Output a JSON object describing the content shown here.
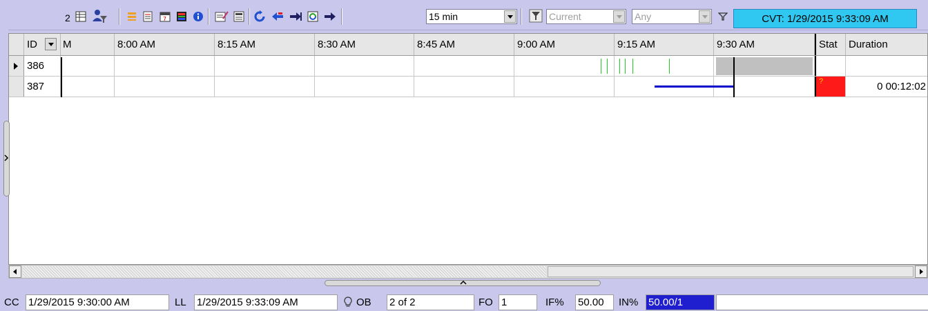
{
  "toolbar": {
    "record_count": "2",
    "icons": [
      "grid-view-icon",
      "filter-user-icon",
      "list-icon",
      "notes-icon",
      "calendar-icon",
      "color-scale-icon",
      "info-icon",
      "edit-sheet-icon",
      "report-icon",
      "refresh-icon",
      "previous-icon",
      "next-icon",
      "sync-icon",
      "forward-icon"
    ],
    "interval": {
      "value": "15 min"
    },
    "filter_icon": "filter-query-icon",
    "scope": {
      "value": "Current"
    },
    "match": {
      "value": "Any"
    },
    "funnel_icon": "funnel-icon",
    "cvt": "CVT: 1/29/2015 9:33:09 AM",
    "colors": {
      "cvt_bg": "#30c8f0"
    }
  },
  "grid": {
    "headers": {
      "id": "ID",
      "partial_time": "M",
      "times": [
        "8:00 AM",
        "8:15 AM",
        "8:30 AM",
        "8:45 AM",
        "9:00 AM",
        "9:15 AM",
        "9:30 AM"
      ],
      "stat": "Stat",
      "duration": "Duration"
    },
    "rows": [
      {
        "id": "386",
        "stat": "",
        "duration": "",
        "selected": true
      },
      {
        "id": "387",
        "stat": "?",
        "duration": "0 00:12:02",
        "selected": false
      }
    ],
    "colors": {
      "stat_alert": "#ff1a1a",
      "bar_blue": "#0000cc",
      "tick_green": "#22cc22",
      "block_gray": "#c0c0c0"
    }
  },
  "status": {
    "cc_label": "CC",
    "cc_value": "1/29/2015 9:30:00 AM",
    "ll_label": "LL",
    "ll_value": "1/29/2015 9:33:09 AM",
    "ob_label": "OB",
    "ob_value": "2 of 2",
    "fo_label": "FO",
    "fo_value": "1",
    "if_label": "IF%",
    "if_value": "50.00",
    "in_label": "IN%",
    "in_value": "50.00/1",
    "bulb_icon": "lightbulb-icon"
  }
}
